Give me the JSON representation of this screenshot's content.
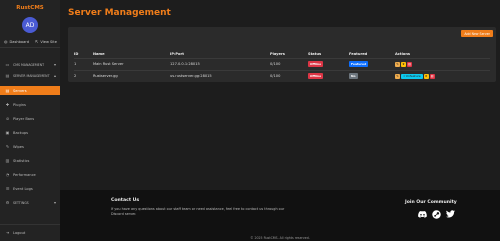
{
  "app": {
    "brand": "RustCMS",
    "avatar_initials": "AD"
  },
  "user_links": {
    "dashboard": "Dashboard",
    "view_site": "View Site"
  },
  "sidebar": {
    "sections": [
      {
        "label": "CMS MANAGEMENT",
        "caret": "▾"
      },
      {
        "label": "SERVER MANAGEMENT",
        "caret": "▴"
      }
    ],
    "items": [
      {
        "label": "Servers",
        "icon": "server-icon",
        "glyph": "▤",
        "active": true
      },
      {
        "label": "Plugins",
        "icon": "puzzle-icon",
        "glyph": "✚",
        "active": false
      },
      {
        "label": "Player Bans",
        "icon": "ban-icon",
        "glyph": "⊘",
        "active": false
      },
      {
        "label": "Backups",
        "icon": "database-icon",
        "glyph": "▣",
        "active": false
      },
      {
        "label": "Wipes",
        "icon": "broom-icon",
        "glyph": "✎",
        "active": false
      },
      {
        "label": "Statistics",
        "icon": "chart-icon",
        "glyph": "▥",
        "active": false
      },
      {
        "label": "Performance",
        "icon": "gauge-icon",
        "glyph": "◔",
        "active": false
      },
      {
        "label": "Event Logs",
        "icon": "list-icon",
        "glyph": "☰",
        "active": false
      },
      {
        "label": "SETTINGS",
        "icon": "gear-icon",
        "glyph": "⚙",
        "active": false
      }
    ],
    "logout": "Logout"
  },
  "page": {
    "title": "Server Management",
    "add_button": "Add New Server"
  },
  "table": {
    "headers": {
      "id": "ID",
      "name": "Name",
      "ip_port": "IP:Port",
      "players": "Players",
      "status": "Status",
      "featured": "Featured",
      "actions": "Actions"
    },
    "rows": [
      {
        "id": "1",
        "name": "Main Rust Server",
        "ip_port": "127.0.0.1:28015",
        "players": "0/100",
        "status": "Offline",
        "featured": "Featured",
        "unfeature": ""
      },
      {
        "id": "2",
        "name": "Rustserver.gg",
        "ip_port": "us.rustserver.gg:28015",
        "players": "0/100",
        "status": "Offline",
        "featured": "No",
        "unfeature": "Unfeature"
      }
    ]
  },
  "footer": {
    "contact_title": "Contact Us",
    "contact_text": "If you have any questions about our staff team or need assistance, feel free to contact us through our Discord server.",
    "community_title": "Join Our Community",
    "copyright": "© 2025 RustCMS. All rights reserved."
  },
  "colors": {
    "accent": "#f07d1a",
    "offline": "#dc3545",
    "featured": "#0d6efd",
    "no": "#6c757d"
  }
}
